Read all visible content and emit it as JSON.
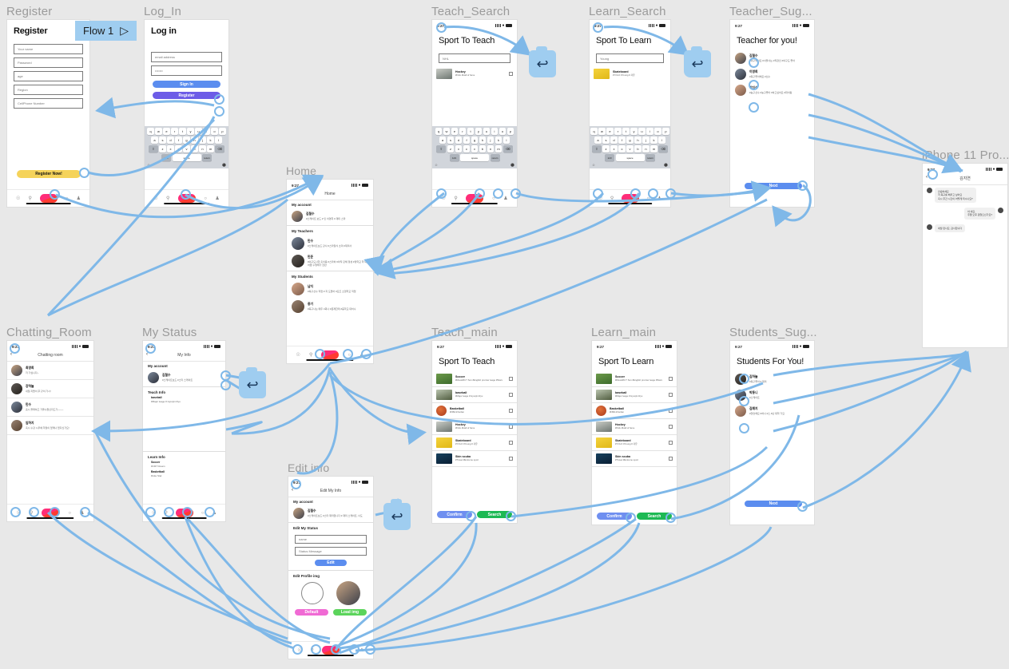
{
  "flow": {
    "label": "Flow 1",
    "play_icon": "play-triangle-icon"
  },
  "colors": {
    "link": "#7fb8e8",
    "badge": "#9fcdf0",
    "frame_title": "#9b9b9b"
  },
  "status_bar": {
    "time": "9:27",
    "signal_icon": "signal-bars-icon",
    "wifi_icon": "wifi-icon",
    "battery_icon": "battery-icon"
  },
  "keyboard": {
    "row1": [
      "q",
      "w",
      "e",
      "r",
      "t",
      "y",
      "u",
      "i",
      "o",
      "p"
    ],
    "row2": [
      "a",
      "s",
      "d",
      "f",
      "g",
      "h",
      "j",
      "k",
      "l"
    ],
    "row3": [
      "⇧",
      "z",
      "x",
      "c",
      "v",
      "b",
      "n",
      "m",
      "⌫"
    ],
    "row4": [
      "123",
      "space",
      "return"
    ],
    "emoji_icon": "emoji-icon",
    "mic_icon": "mic-icon"
  },
  "bottom_nav": {
    "home_icon": "home-icon",
    "search_icon": "search-icon",
    "logo_icon": "app-logo-icon",
    "circle_icon": "circle-icon",
    "profile_icon": "person-icon"
  },
  "frames": {
    "register": {
      "title": "Register",
      "heading": "Register",
      "fields": [
        {
          "placeholder": "Your name"
        },
        {
          "placeholder": "Password"
        },
        {
          "placeholder": "age"
        },
        {
          "placeholder": "Region"
        },
        {
          "placeholder": "CellPhone Number"
        }
      ],
      "submit": "Register Now!",
      "submit_color": "#f5d35a"
    },
    "login": {
      "title": "Log_In",
      "heading": "Log in",
      "email_placeholder": "email address",
      "password_value": "•••••••",
      "signin": "Sign In",
      "signin_color": "#5b8def",
      "register": "Register",
      "register_color": "#6d5ce7"
    },
    "teach_search": {
      "title": "Teach_Search",
      "heading": "Sport To Teach",
      "query": "NHL",
      "results": [
        {
          "name": "Hockey",
          "tags": "#NHL #Hall of fame",
          "img": "hockey"
        }
      ]
    },
    "learn_search": {
      "title": "Learn_Search",
      "heading": "Sport To Learn",
      "query": "Young",
      "results": [
        {
          "name": "Skateboard",
          "tags": "#YOLO #Young # 자유",
          "img": "skate"
        }
      ]
    },
    "teacher_sug": {
      "title": "Teacher_Sug...",
      "heading": "Teacher for you!",
      "people": [
        {
          "name": "김철수",
          "desc": "#야구좋아요 #서울사는 #직장인 #야구도 좋아"
        },
        {
          "name": "이영희",
          "desc": "#축구좋아해요 #선수"
        },
        {
          "name": "박지성",
          "desc": "#농구선수 #농구좋아 #하고싶어요 #화이팅"
        }
      ],
      "next": "Next",
      "next_color": "#5b8def"
    },
    "chat": {
      "title": "iPhone 11 Pro...",
      "nav_title": "김지연",
      "messages": [
        {
          "side": "left",
          "text": "안녕하세요\n저 축구를 배우고 싶어요\n혹시 주간 시간이 어떻게 되시나요?"
        },
        {
          "side": "right",
          "text": "아 네요,\n주말 오후 괜찮으신가요?"
        },
        {
          "side": "left",
          "text": "네월 만나요, 감사합니다"
        }
      ]
    },
    "home": {
      "title": "Home",
      "nav_title": "Home",
      "sections": [
        {
          "label": "My account",
          "people": [
            {
              "name": "김철수",
              "desc": "#스케이트 보드 # 인 이영희 # 재미 스타"
            }
          ]
        },
        {
          "label": "My Teachers",
          "people": [
            {
              "name": "민수",
              "desc": "#스케이트보드 강사 #스타일식 초미 #재미사"
            },
            {
              "name": "민준",
              "desc": "#야구도나한 홍이용 #스타하 #아직 단채 정성 #영학교 학 대어옆 수행해가 한만"
            }
          ]
        },
        {
          "label": "My Students",
          "people": [
            {
              "name": "남지",
              "desc": "#축구선수 직업 # 지 도들어 #요즈 소형학교 직업"
            },
            {
              "name": "중기",
              "desc": "#축구나는 매주 3회나 #문제한테 #중학교 대어수"
            }
          ]
        }
      ]
    },
    "chatting_room": {
      "title": "Chatting_Room",
      "nav_title": "Chatting room",
      "rows": [
        {
          "name": "최영희",
          "preview": "저 가십니다~"
        },
        {
          "name": "강하늘",
          "preview": "내일 지들이 후 같이 가시!"
        },
        {
          "name": "민수",
          "preview": "홈시 올래하고 가울수들신지드가~~~~"
        },
        {
          "name": "임하지",
          "preview": "혹시 수강 시우에 학정이 없래나 없다신가요!"
        }
      ]
    },
    "my_status": {
      "title": "My Status",
      "nav_title": "My Info",
      "account_label": "My account",
      "account": {
        "name": "김철수",
        "desc": "#스케이트보드 #스타 스케이트"
      },
      "teach_label": "Teach Info",
      "teach": [
        {
          "sport": "baseball",
          "tags": "#Major leage # Hyunjin Ryu"
        }
      ],
      "learn_label": "Learn Info",
      "learn": [
        {
          "sport": "Soccer",
          "tags": "#CR7 Dream"
        },
        {
          "sport": "Basketball",
          "tags": "#Like Star"
        }
      ]
    },
    "teach_main": {
      "title": "Teach_main",
      "heading": "Sport To Teach",
      "sports": [
        {
          "name": "Soccer",
          "tags": "#Messi#Cr7 Son #English premier leage #Stars",
          "img": "soccer"
        },
        {
          "name": "baseball",
          "tags": "#Major leage # Hyunjin Ryu",
          "img": "baseball"
        },
        {
          "name": "Basketball",
          "tags": "#NBA #Jordan",
          "img": "basketball"
        },
        {
          "name": "Hockey",
          "tags": "#NHL #Hall of fame",
          "img": "hockey"
        },
        {
          "name": "Skateboard",
          "tags": "#YOLO #Young # 자유",
          "img": "skate"
        },
        {
          "name": "Skin scuba",
          "tags": "#Travel #Extreme sport",
          "img": "scuba"
        }
      ],
      "confirm": "Confirm",
      "confirm_color": "#6f8ff0",
      "search": "Search",
      "search_color": "#1db954"
    },
    "learn_main": {
      "title": "Learn_main",
      "heading": "Sport To Learn",
      "sports": [
        {
          "name": "Soccer",
          "tags": "#Messi#Cr7 Son #English premier leage #Stars",
          "img": "soccer"
        },
        {
          "name": "baseball",
          "tags": "#Major leage # Hyunjin Ryu",
          "img": "baseball"
        },
        {
          "name": "Basketball",
          "tags": "#NBA #Jordan",
          "img": "basketball"
        },
        {
          "name": "Hockey",
          "tags": "#NHL #Hall of fame",
          "img": "hockey"
        },
        {
          "name": "Skateboard",
          "tags": "#YOLO #Young # 자유",
          "img": "skate"
        },
        {
          "name": "Skin scuba",
          "tags": "#Travel #Extreme sport",
          "img": "scuba"
        }
      ],
      "confirm": "Confirm",
      "confirm_color": "#6f8ff0",
      "search": "Search",
      "search_color": "#1db954"
    },
    "students_sug": {
      "title": "Students_Sug...",
      "heading": "Students For You!",
      "people": [
        {
          "name": "김하늘",
          "desc": "#축구좋아 # 재미"
        },
        {
          "name": "박동니",
          "desc": "#스케이트"
        },
        {
          "name": "김예지",
          "desc": "#연습해요 #하나 #스 #난 대학 가요"
        }
      ],
      "next": "Next",
      "next_color": "#5b8def"
    },
    "edit_info": {
      "title": "Edit info",
      "nav_title": "Edit My Info",
      "account_label": "My account",
      "account": {
        "name": "김철수",
        "desc": "#스케이트보드 #스타 재미입니다 # 재미 스케이트, 너도"
      },
      "status_label": "Edit My Status",
      "name_placeholder": "name",
      "status_placeholder": "Status Message",
      "edit_button": "Edit",
      "edit_color": "#5b8def",
      "profile_label": "Edit Profile img",
      "default_button": "Default",
      "default_color": "#f06ad4",
      "load_button": "Load img",
      "load_color": "#5bd45b"
    }
  }
}
